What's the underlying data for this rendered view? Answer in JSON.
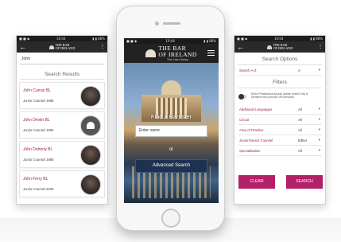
{
  "status_bar": {
    "left": "■ ■ ◆",
    "time": "10:04",
    "right": "▮ ▮ 88%"
  },
  "brand": {
    "title_line1": "THE BAR",
    "title_line2": "OF IRELAND",
    "subtitle": "The Law Library"
  },
  "left_phone": {
    "search_value": "John",
    "results_title": "Search Results",
    "results": [
      {
        "name": "John Curran BL",
        "meta": "Junior Counsel  1988"
      },
      {
        "name": "John Devlin BL",
        "meta": "Junior Counsel  1995"
      },
      {
        "name": "John Doherty BL",
        "meta": "Junior Counsel  1986"
      },
      {
        "name": "John Ferry BL",
        "meta": "Junior Counsel  2005"
      }
    ]
  },
  "center_phone": {
    "hero_title": "Find a Barrister",
    "name_placeholder": "Enter name",
    "or_text": "or",
    "advanced_search_label": "Advanced Search"
  },
  "right_phone": {
    "search_options_title": "Search Options",
    "search_az": {
      "label": "Search A-Z",
      "value": "A"
    },
    "filters_title": "Filters",
    "toggle_text": "Direct Professional Access (switch search only to barristers who provide DPA services)",
    "filters": [
      {
        "label": "Additional Languages",
        "value": "All"
      },
      {
        "label": "Circuit",
        "value": "All"
      },
      {
        "label": "Area of Practice",
        "value": "All"
      },
      {
        "label": "Junior/Senior Counsel",
        "value": "Either"
      },
      {
        "label": "Specialisation",
        "value": "All"
      }
    ],
    "clear_label": "CLEAR",
    "search_label": "SEARCH"
  },
  "colors": {
    "accent": "#b41f6a",
    "header": "#2a2a2a",
    "button_dark": "#1e3250"
  }
}
